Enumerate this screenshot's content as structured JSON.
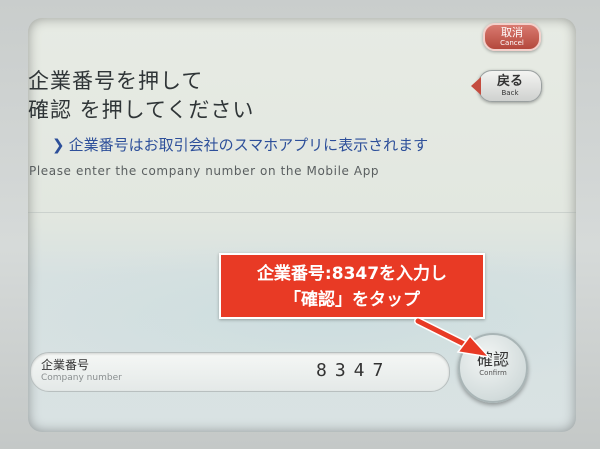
{
  "header": {
    "cancel": {
      "label_jp": "取消",
      "label_en": "Cancel"
    },
    "back": {
      "label_jp": "戻る",
      "label_en": "Back"
    }
  },
  "title": {
    "line1": "企業番号を押して",
    "line2": "確認 を押してください"
  },
  "hint": {
    "chevron": "❯",
    "text_jp": "企業番号はお取引会社のスマホアプリに表示されます",
    "text_en": "Please enter the company number on the Mobile App"
  },
  "field": {
    "label_jp": "企業番号",
    "label_en": "Company number",
    "value": "8347"
  },
  "confirm": {
    "label_jp": "確認",
    "label_en": "Confirm"
  },
  "annotation": {
    "line1": "企業番号:8347を入力し",
    "line2": "「確認」をタップ"
  },
  "colors": {
    "accent_red": "#e83a25",
    "hint_blue": "#2d4f9a",
    "cancel_red": "#b4483c"
  }
}
